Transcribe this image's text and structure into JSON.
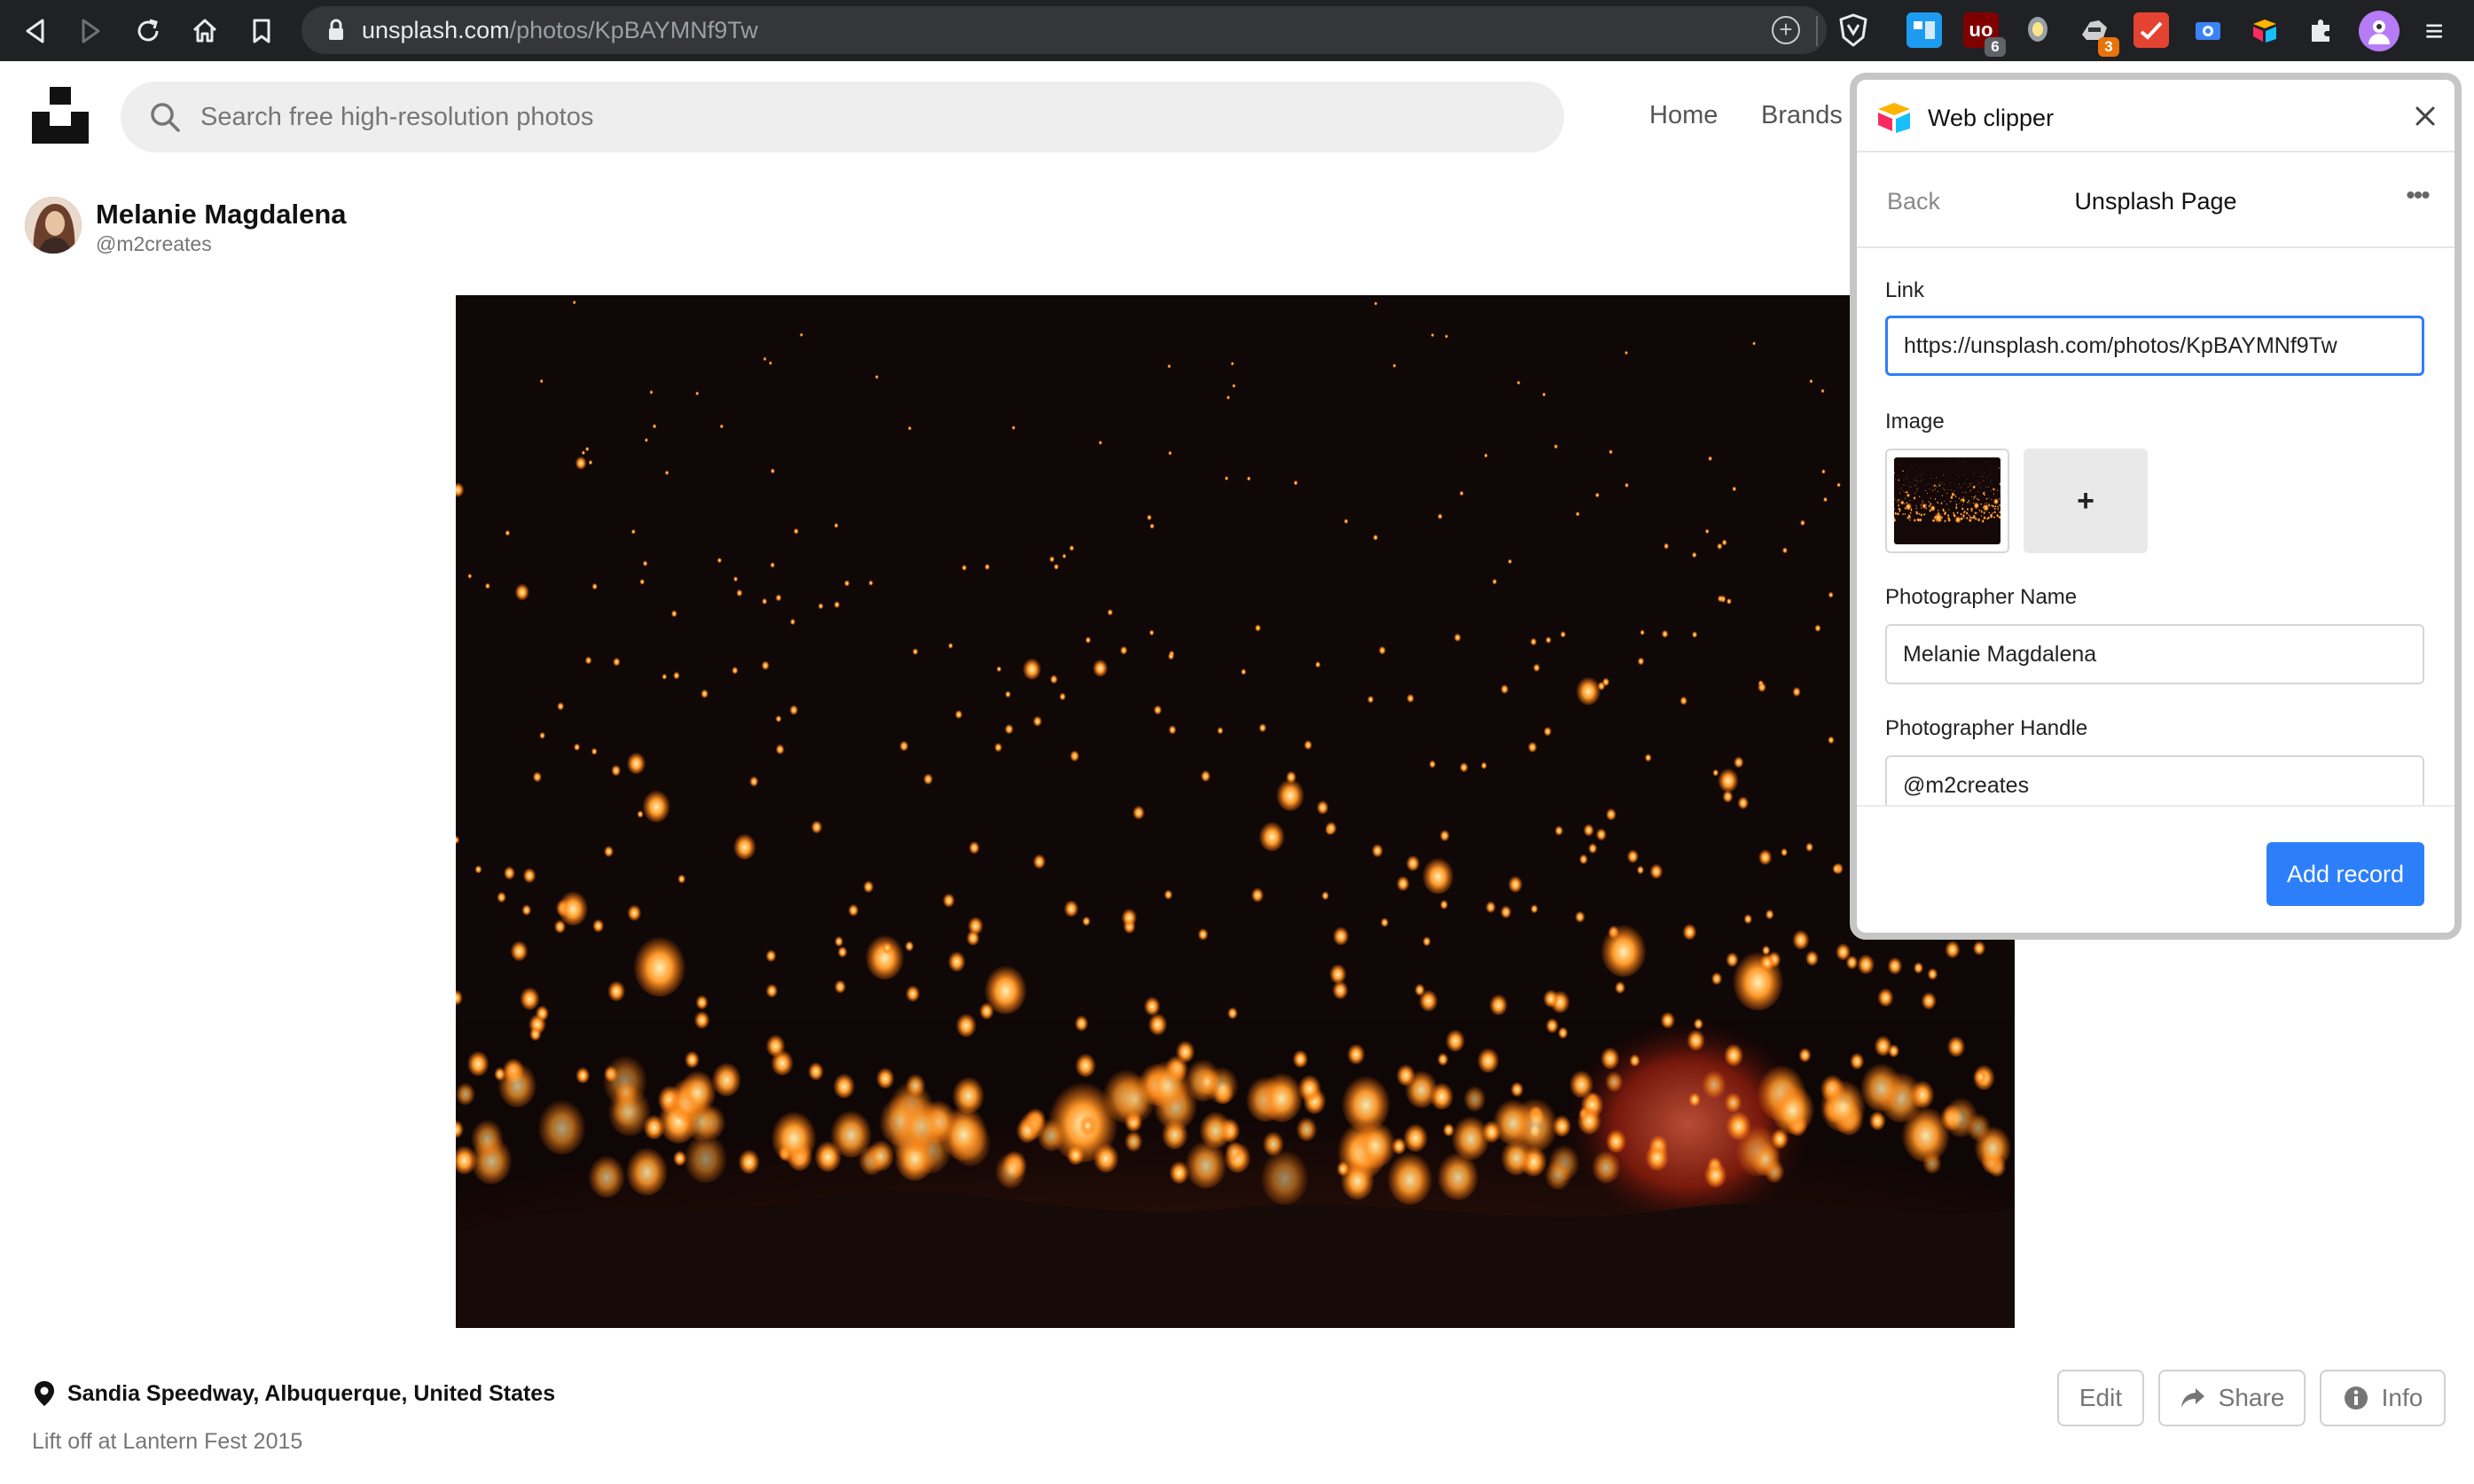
{
  "browser": {
    "url_host": "unsplash.com",
    "url_path": "/photos/KpBAYMNf9Tw",
    "extensions": [
      {
        "name": "tweetdeck-icon",
        "color": "#1d9bf0",
        "badge": ""
      },
      {
        "name": "ublock-origin-icon",
        "color": "#800000",
        "badge": "6"
      },
      {
        "name": "bulb-icon",
        "color": "#5a5a5a",
        "badge": ""
      },
      {
        "name": "raccoon-icon",
        "color": "#5a5a5a",
        "badge": "3"
      },
      {
        "name": "todoist-icon",
        "color": "#e44332",
        "badge": ""
      },
      {
        "name": "screenshot-icon",
        "color": "#3b82f6",
        "badge": ""
      },
      {
        "name": "airtable-icon",
        "color": "#fcb400",
        "badge": ""
      },
      {
        "name": "puzzle-icon",
        "color": "#e8eaed",
        "badge": ""
      }
    ]
  },
  "site": {
    "search_placeholder": "Search free high-resolution photos",
    "nav": [
      "Home",
      "Brands"
    ]
  },
  "photographer": {
    "name": "Melanie Magdalena",
    "handle": "@m2creates"
  },
  "photo": {
    "location": "Sandia Speedway, Albuquerque, United States",
    "description": "Lift off at Lantern Fest 2015",
    "actions": {
      "edit": "Edit",
      "share": "Share",
      "info": "Info"
    }
  },
  "clipper": {
    "title": "Web clipper",
    "back_label": "Back",
    "page_title": "Unsplash Page",
    "fields": {
      "link_label": "Link",
      "link_value": "https://unsplash.com/photos/KpBAYMNf9Tw",
      "image_label": "Image",
      "add_image": "+",
      "name_label": "Photographer Name",
      "name_value": "Melanie Magdalena",
      "handle_label": "Photographer Handle",
      "handle_value": "@m2creates"
    },
    "submit_label": "Add record",
    "accent_color": "#2d7ff9"
  }
}
